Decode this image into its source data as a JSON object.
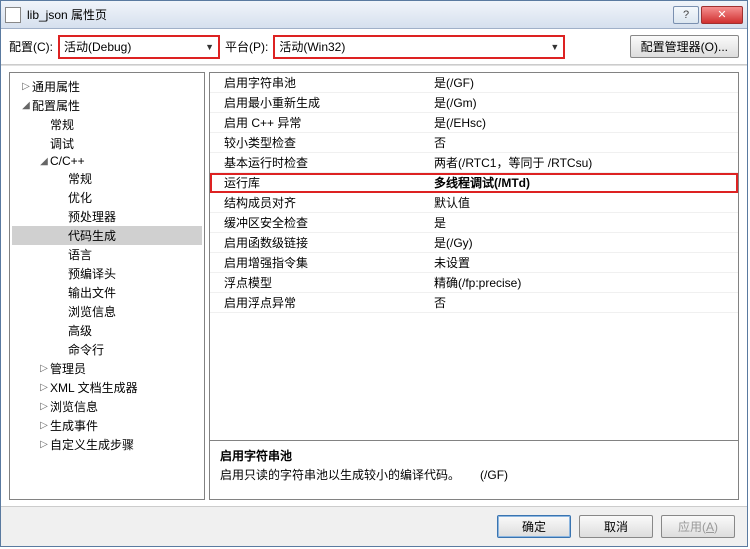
{
  "window": {
    "title": "lib_json 属性页"
  },
  "toolbar": {
    "config_label": "配置(C):",
    "config_value": "活动(Debug)",
    "platform_label": "平台(P):",
    "platform_value": "活动(Win32)",
    "config_mgr": "配置管理器(O)..."
  },
  "tree": [
    {
      "label": "通用属性",
      "depth": 0,
      "toggle": "▷"
    },
    {
      "label": "配置属性",
      "depth": 0,
      "toggle": "◢"
    },
    {
      "label": "常规",
      "depth": 1,
      "toggle": ""
    },
    {
      "label": "调试",
      "depth": 1,
      "toggle": ""
    },
    {
      "label": "C/C++",
      "depth": 1,
      "toggle": "◢"
    },
    {
      "label": "常规",
      "depth": 2,
      "toggle": ""
    },
    {
      "label": "优化",
      "depth": 2,
      "toggle": ""
    },
    {
      "label": "预处理器",
      "depth": 2,
      "toggle": ""
    },
    {
      "label": "代码生成",
      "depth": 2,
      "toggle": "",
      "selected": true
    },
    {
      "label": "语言",
      "depth": 2,
      "toggle": ""
    },
    {
      "label": "预编译头",
      "depth": 2,
      "toggle": ""
    },
    {
      "label": "输出文件",
      "depth": 2,
      "toggle": ""
    },
    {
      "label": "浏览信息",
      "depth": 2,
      "toggle": ""
    },
    {
      "label": "高级",
      "depth": 2,
      "toggle": ""
    },
    {
      "label": "命令行",
      "depth": 2,
      "toggle": ""
    },
    {
      "label": "管理员",
      "depth": 1,
      "toggle": "▷"
    },
    {
      "label": "XML 文档生成器",
      "depth": 1,
      "toggle": "▷"
    },
    {
      "label": "浏览信息",
      "depth": 1,
      "toggle": "▷"
    },
    {
      "label": "生成事件",
      "depth": 1,
      "toggle": "▷"
    },
    {
      "label": "自定义生成步骤",
      "depth": 1,
      "toggle": "▷"
    }
  ],
  "props": [
    {
      "name": "启用字符串池",
      "value": "是(/GF)"
    },
    {
      "name": "启用最小重新生成",
      "value": "是(/Gm)"
    },
    {
      "name": "启用 C++ 异常",
      "value": "是(/EHsc)"
    },
    {
      "name": "较小类型检查",
      "value": "否"
    },
    {
      "name": "基本运行时检查",
      "value": "两者(/RTC1，等同于 /RTCsu)"
    },
    {
      "name": "运行库",
      "value": "多线程调试(/MTd)",
      "hl": true
    },
    {
      "name": "结构成员对齐",
      "value": "默认值"
    },
    {
      "name": "缓冲区安全检查",
      "value": "是"
    },
    {
      "name": "启用函数级链接",
      "value": "是(/Gy)"
    },
    {
      "name": "启用增强指令集",
      "value": "未设置"
    },
    {
      "name": "浮点模型",
      "value": "精确(/fp:precise)"
    },
    {
      "name": "启用浮点异常",
      "value": "否"
    }
  ],
  "desc": {
    "title": "启用字符串池",
    "text": "启用只读的字符串池以生成较小的编译代码。",
    "flag": "(/GF)"
  },
  "footer": {
    "ok": "确定",
    "cancel": "取消",
    "apply": "应用(A)"
  }
}
